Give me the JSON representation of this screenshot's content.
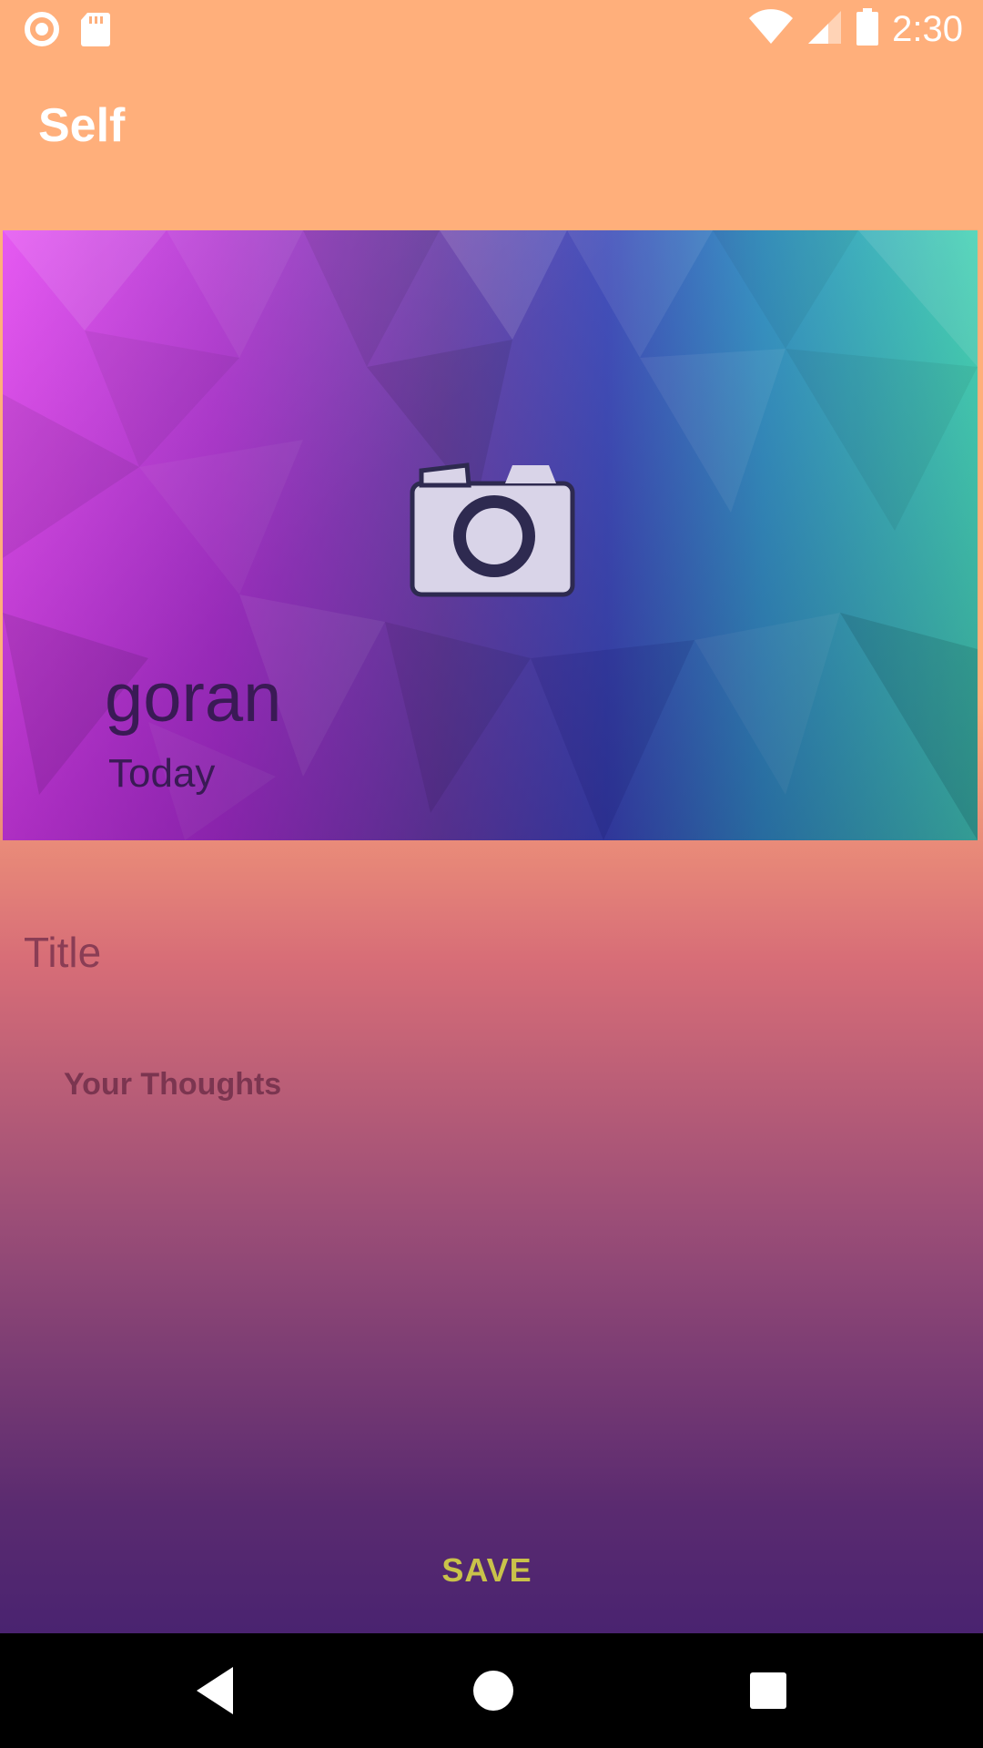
{
  "status_bar": {
    "time": "2:30",
    "icons": [
      "circle-icon",
      "sd-card-icon",
      "wifi-icon",
      "signal-icon",
      "battery-icon"
    ]
  },
  "app_bar": {
    "title": "Self",
    "background": "#ffaf7b"
  },
  "hero": {
    "name": "goran",
    "date": "Today",
    "icon": "camera-icon"
  },
  "form": {
    "title_placeholder": "Title",
    "thoughts_placeholder": "Your Thoughts",
    "save_label": "SAVE",
    "save_color": "#c9c24a"
  },
  "nav_bar": {
    "icons": [
      "back-icon",
      "home-icon",
      "recents-icon"
    ]
  }
}
